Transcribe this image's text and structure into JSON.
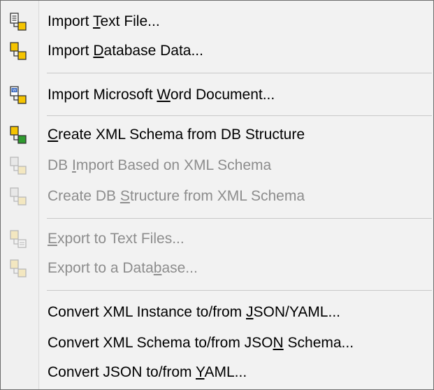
{
  "menu": {
    "items": [
      {
        "pre": "Import ",
        "key": "T",
        "post": "ext File...",
        "icon": "import-text-file-icon",
        "enabled": true
      },
      {
        "pre": "Import ",
        "key": "D",
        "post": "atabase Data...",
        "icon": "import-database-icon",
        "enabled": true
      },
      {
        "pre": "Import Microsoft ",
        "key": "W",
        "post": "ord Document...",
        "icon": "import-word-document-icon",
        "enabled": true
      },
      {
        "pre": "",
        "key": "C",
        "post": "reate XML Schema from DB Structure",
        "icon": "create-schema-from-db-icon",
        "enabled": true
      },
      {
        "pre": "DB ",
        "key": "I",
        "post": "mport Based on XML Schema",
        "icon": "db-import-schema-icon",
        "enabled": false
      },
      {
        "pre": "Create DB ",
        "key": "S",
        "post": "tructure from XML Schema",
        "icon": "create-db-structure-icon",
        "enabled": false
      },
      {
        "pre": "",
        "key": "E",
        "post": "xport to Text Files...",
        "icon": "export-text-files-icon",
        "enabled": false
      },
      {
        "pre": "Export to a Data",
        "key": "b",
        "post": "ase...",
        "icon": "export-database-icon",
        "enabled": false
      },
      {
        "pre": "Convert XML Instance to/from ",
        "key": "J",
        "post": "SON/YAML...",
        "icon": "",
        "enabled": true
      },
      {
        "pre": "Convert XML Schema to/from JSO",
        "key": "N",
        "post": " Schema...",
        "icon": "",
        "enabled": true
      },
      {
        "pre": "Convert JSON to/from ",
        "key": "Y",
        "post": "AML...",
        "icon": "",
        "enabled": true
      }
    ]
  },
  "colors": {
    "text": "#000000",
    "disabled_text": "#8d8d8d",
    "menu_bg": "#f2f2f2",
    "icon_yellow": "#f5c400",
    "icon_green": "#2e9b2e"
  }
}
